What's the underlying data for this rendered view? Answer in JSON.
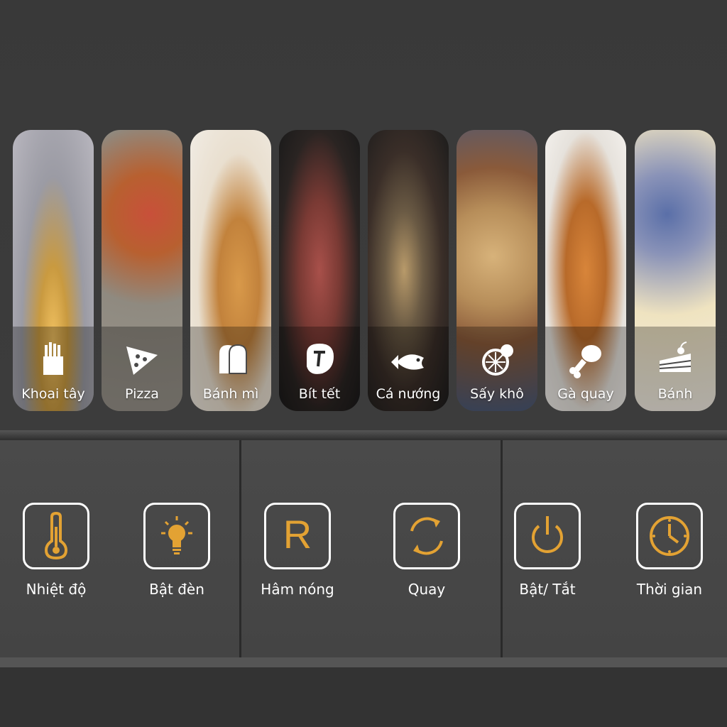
{
  "presets": [
    {
      "label": "Khoai tây",
      "icon": "fries-icon"
    },
    {
      "label": "Pizza",
      "icon": "pizza-icon"
    },
    {
      "label": "Bánh mì",
      "icon": "bread-icon"
    },
    {
      "label": "Bít tết",
      "icon": "steak-icon"
    },
    {
      "label": "Cá nướng",
      "icon": "fish-icon"
    },
    {
      "label": "Sấy khô",
      "icon": "dried-fruit-icon"
    },
    {
      "label": "Gà quay",
      "icon": "chicken-leg-icon"
    },
    {
      "label": "Bánh",
      "icon": "cake-icon"
    }
  ],
  "controls": [
    {
      "label": "Nhiệt độ",
      "icon": "thermometer-icon"
    },
    {
      "label": "Bật đèn",
      "icon": "lightbulb-icon"
    },
    {
      "label": "Hâm nóng",
      "icon": "reheat-r-icon",
      "glyph": "R"
    },
    {
      "label": "Quay",
      "icon": "rotate-icon"
    },
    {
      "label": "Bật/ Tắt",
      "icon": "power-icon"
    },
    {
      "label": "Thời gian",
      "icon": "clock-icon"
    }
  ],
  "colors": {
    "accent": "#e3a233",
    "background": "#3a3a3a",
    "panel": "#484848",
    "text": "#ffffff"
  }
}
